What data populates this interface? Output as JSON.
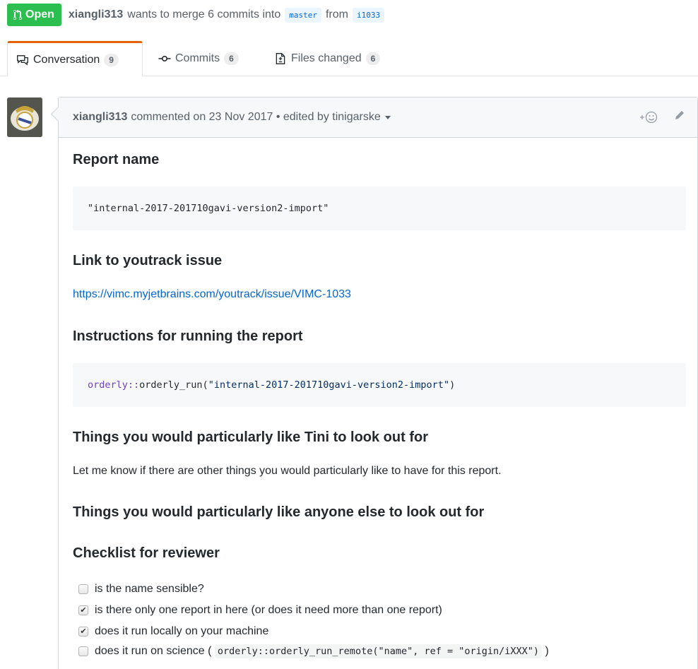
{
  "pr": {
    "state": "Open",
    "author": "xiangli313",
    "summary": "wants to merge 6 commits into",
    "base_branch": "master",
    "from_word": "from",
    "head_branch": "i1033"
  },
  "tabs": [
    {
      "label": "Conversation",
      "count": "9",
      "icon": "comment-discussion-icon"
    },
    {
      "label": "Commits",
      "count": "6",
      "icon": "commit-icon"
    },
    {
      "label": "Files changed",
      "count": "6",
      "icon": "file-diff-icon"
    }
  ],
  "comment": {
    "author": "xiangli313",
    "meta": "commented on 23 Nov 2017 • edited by tinigarske",
    "actions": [
      "add-reaction-icon",
      "pencil-icon"
    ]
  },
  "body": {
    "h_report_name": "Report name",
    "code_report_name": "\"internal-2017-201710gavi-version2-import\"",
    "h_link": "Link to youtrack issue",
    "link_url": "https://vimc.myjetbrains.com/youtrack/issue/VIMC-1033",
    "h_instructions": "Instructions for running the report",
    "code_ns": "orderly::",
    "code_fn": "orderly_run(",
    "code_arg": "\"internal-2017-201710gavi-version2-import\"",
    "code_close": ")",
    "h_tini": "Things you would particularly like Tini to look out for",
    "p_tini": "Let me know if there are other things you would particularly like to have for this report.",
    "h_anyone": "Things you would particularly like anyone else to look out for",
    "h_checklist": "Checklist for reviewer",
    "tasks": [
      {
        "label": "is the name sensible?",
        "checked": false
      },
      {
        "label": "is there only one report in here (or does it need more than one report)",
        "checked": true
      },
      {
        "label": "does it run locally on your machine",
        "checked": true
      },
      {
        "label": "does it run on science (",
        "checked": false,
        "code": "orderly::orderly_run_remote(\"name\", ref = \"origin/iXXX\")",
        "after": ")"
      }
    ]
  },
  "colors": {
    "open_green": "#2cbe4e",
    "link_blue": "#0366d6",
    "tab_accent": "#e36209"
  }
}
